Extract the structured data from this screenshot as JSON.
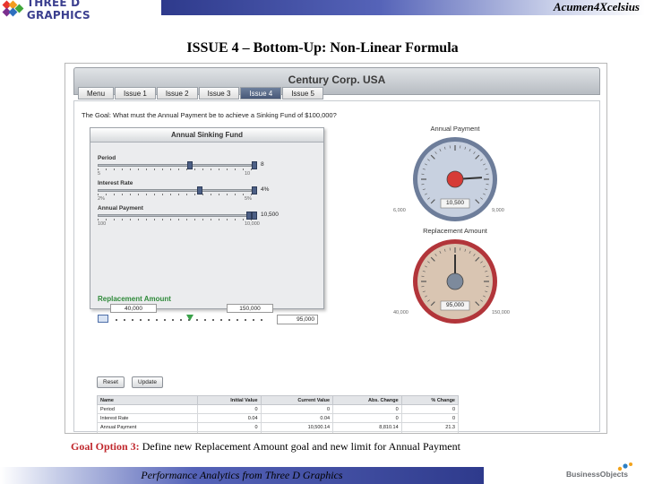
{
  "header": {
    "logo_text": "THREE D GRAPHICS",
    "brand": "Acumen4Xcelsius",
    "logo_colors": [
      "#e8352e",
      "#f29c1f",
      "#7b2f8e",
      "#2e6fbf",
      "#3fa63a"
    ]
  },
  "slide_title": "ISSUE 4 – Bottom-Up: Non-Linear Formula",
  "app": {
    "title": "Century Corp. USA",
    "tabs": [
      {
        "label": "Menu",
        "active": false
      },
      {
        "label": "Issue 1",
        "active": false
      },
      {
        "label": "Issue 2",
        "active": false
      },
      {
        "label": "Issue 3",
        "active": false
      },
      {
        "label": "Issue 4",
        "active": true
      },
      {
        "label": "Issue 5",
        "active": false
      }
    ],
    "goal_line": "The Goal: What must the Annual Payment be to achieve a Sinking Fund of $100,000?",
    "panel": {
      "title": "Annual Sinking Fund",
      "sliders": [
        {
          "label": "Period",
          "min": "5",
          "max": "10",
          "value": "8",
          "level": 0.6
        },
        {
          "label": "Interest Rate",
          "min": "2%",
          "max": "5%",
          "value": "4%",
          "level": 0.67
        },
        {
          "label": "Annual Payment",
          "min": "100",
          "max": "10,000",
          "value": "10,500",
          "level": 1.0
        }
      ],
      "replacement": {
        "label": "Replacement Amount",
        "low_box": "40,000",
        "high_box": "150,000",
        "input_value": "95,000",
        "level": 0.5
      }
    },
    "gauges": [
      {
        "label": "Annual Payment",
        "min": "6,000",
        "max": "9,000",
        "readout": "10,500",
        "level": 0.82,
        "face": "#c8d1e0",
        "rim": "#6d7d9a",
        "needle": "#d63b36"
      },
      {
        "label": "Replacement Amount",
        "min": "40,000",
        "max": "150,000",
        "readout": "95,000",
        "level": 0.5,
        "face": "#d9c5b2",
        "rim": "#b2353a",
        "needle": "#7d8a9c"
      }
    ],
    "buttons": {
      "reset": "Reset",
      "update": "Update"
    },
    "table": {
      "columns": [
        "Name",
        "Initial Value",
        "Current Value",
        "Abs. Change",
        "% Change"
      ],
      "rows": [
        [
          "Period",
          "0",
          "0",
          "0",
          "0"
        ],
        [
          "Interest Rate",
          "0.04",
          "0.04",
          "0",
          "0"
        ],
        [
          "Annual Payment",
          "0",
          "10,500.14",
          "8,810.14",
          "21.3"
        ],
        [
          "Replacement Amount",
          "100,000",
          "95,000",
          "(5,000.00)",
          "0"
        ]
      ]
    }
  },
  "caption": {
    "prefix": "Goal Option 3:",
    "text": " Define new Replacement Amount goal and new limit for Annual Payment"
  },
  "footer": {
    "text": "Performance Analytics from Three D Graphics",
    "partner": "BusinessObjects"
  }
}
